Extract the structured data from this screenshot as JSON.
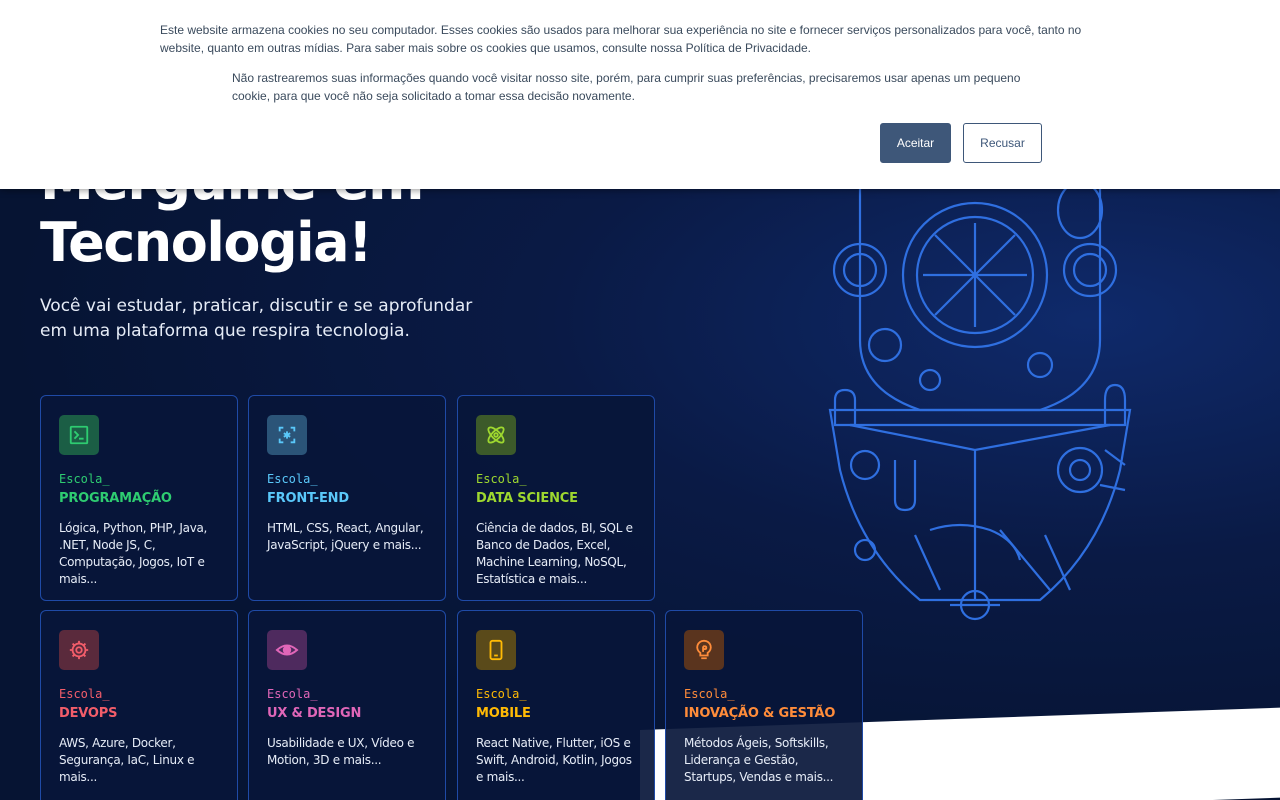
{
  "hero": {
    "headline_line1": "Mergulhe em",
    "headline_line2": "Tecnologia!",
    "subtitle": "Você vai estudar, praticar, discutir e se aprofundar em uma plataforma que respira tecnologia."
  },
  "schools": [
    {
      "prefix": "Escola_",
      "name": "PROGRAMAÇÃO",
      "topics": "Lógica, Python, PHP, Java, .NET, Node JS, C, Computação, Jogos, IoT e mais...",
      "color": "#2ecc71",
      "icon_bg": "#1b5e45",
      "icon": "terminal-icon"
    },
    {
      "prefix": "Escola_",
      "name": "FRONT-END",
      "topics": "HTML, CSS, React, Angular, JavaScript, jQuery e mais...",
      "color": "#5ac8fa",
      "icon_bg": "#2b5478",
      "icon": "brackets-asterisk-icon"
    },
    {
      "prefix": "Escola_",
      "name": "DATA SCIENCE",
      "topics": "Ciência de dados, BI, SQL e Banco de Dados, Excel, Machine Learning, NoSQL, Estatística e mais...",
      "color": "#9ed82f",
      "icon_bg": "#3c5a2a",
      "icon": "atom-icon"
    },
    {
      "prefix": "Escola_",
      "name": "DEVOPS",
      "topics": "AWS, Azure, Docker, Segurança, IaC, Linux e mais...",
      "color": "#f25d6a",
      "icon_bg": "#5a2a3c",
      "icon": "gear-icon"
    },
    {
      "prefix": "Escola_",
      "name": "UX & DESIGN",
      "topics": "Usabilidade e UX, Vídeo e Motion, 3D e mais...",
      "color": "#e066b8",
      "icon_bg": "#4e2a5e",
      "icon": "eye-icon"
    },
    {
      "prefix": "Escola_",
      "name": "MOBILE",
      "topics": "React Native, Flutter, iOS e Swift, Android, Kotlin, Jogos e mais...",
      "color": "#ffba05",
      "icon_bg": "#5a4a1a",
      "icon": "phone-icon"
    },
    {
      "prefix": "Escola_",
      "name": "INOVAÇÃO & GESTÃO",
      "topics": "Métodos Ágeis, Softskills, Liderança e Gestão, Startups, Vendas e mais...",
      "color": "#ff8c3a",
      "icon_bg": "#5a341e",
      "icon": "lightbulb-icon"
    }
  ],
  "cookie_banner": {
    "text1": "Este website armazena cookies no seu computador. Esses cookies são usados para melhorar sua experiência no site e fornecer serviços personalizados para você, tanto no website, quanto em outras mídias. Para saber mais sobre os cookies que usamos, consulte nossa Política de Privacidade.",
    "text2": "Não rastrearemos suas informações quando você visitar nosso site, porém, para cumprir suas preferências, precisaremos usar apenas um pequeno cookie, para que você não seja solicitado a tomar essa decisão novamente.",
    "accept_label": "Aceitar",
    "reject_label": "Recusar"
  }
}
